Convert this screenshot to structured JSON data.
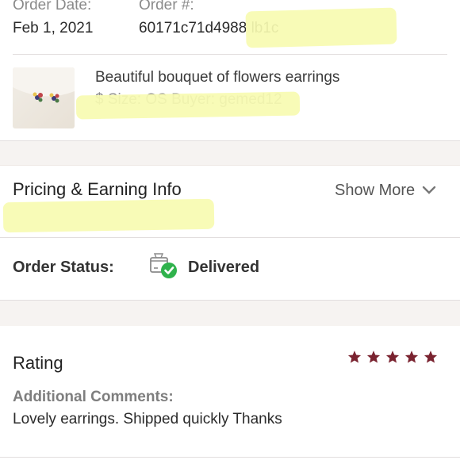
{
  "order": {
    "date_label": "Order Date:",
    "date_value": "Feb 1, 2021",
    "number_label": "Order #:",
    "number_value": "60171c71d4988 lb1c"
  },
  "item": {
    "title": "Beautiful bouquet of flowers earrings",
    "subtitle": "$ Size: OS Buyer: gemed12"
  },
  "pricing": {
    "title": "Pricing & Earning Info",
    "show_more": "Show More"
  },
  "status": {
    "label": "Order Status:",
    "value": "Delivered"
  },
  "rating": {
    "title": "Rating",
    "stars": 5,
    "comments_label": "Additional Comments:",
    "comments": "Lovely earrings. Shipped quickly Thanks"
  },
  "colors": {
    "accent": "#7a2330",
    "success": "#2fb24c",
    "section_bg": "#f6f3f1"
  }
}
